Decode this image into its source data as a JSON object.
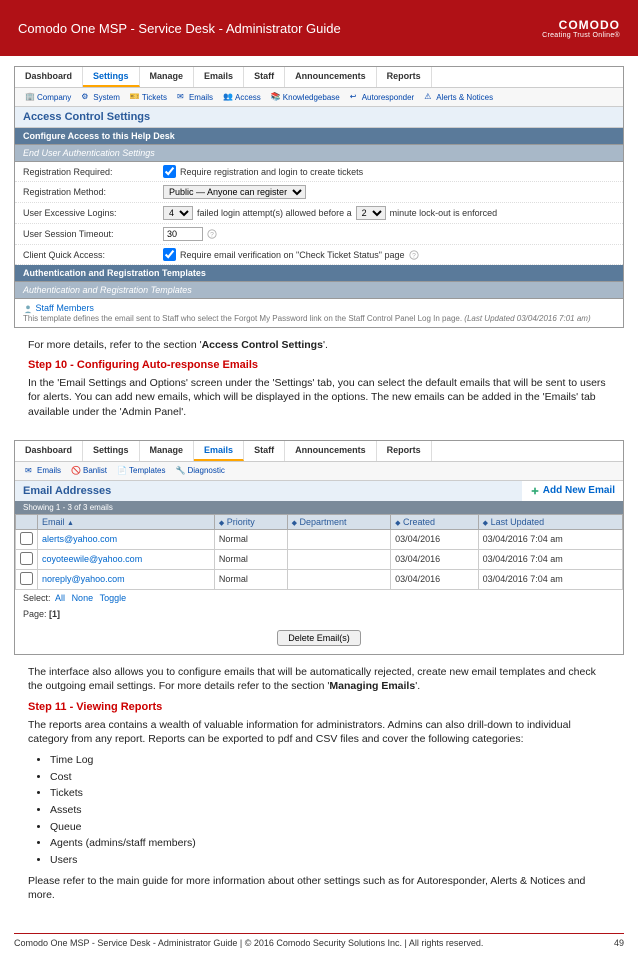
{
  "header": {
    "title": "Comodo One MSP - Service Desk - Administrator Guide",
    "brand": "COMODO",
    "tagline": "Creating Trust Online®"
  },
  "shot1": {
    "tabs": [
      "Dashboard",
      "Settings",
      "Manage",
      "Emails",
      "Staff",
      "Announcements",
      "Reports"
    ],
    "active_tab": 1,
    "subnav": [
      "Company",
      "System",
      "Tickets",
      "Emails",
      "Access",
      "Knowledgebase",
      "Autoresponder",
      "Alerts & Notices"
    ],
    "panel_title": "Access Control Settings",
    "bar1": "Configure Access to this Help Desk",
    "bar2": "End User Authentication Settings",
    "rows": {
      "req_lbl": "Registration Required:",
      "req_val": "Require registration and login to create tickets",
      "method_lbl": "Registration Method:",
      "method_val": "Public — Anyone can register",
      "logins_lbl": "User Excessive Logins:",
      "logins_attempts": "4",
      "logins_text": "failed login attempt(s) allowed before a",
      "logins_minutes": "2",
      "logins_text2": "minute lock-out is enforced",
      "sess_lbl": "User Session Timeout:",
      "sess_val": "30",
      "quick_lbl": "Client Quick Access:",
      "quick_val": "Require email verification on \"Check Ticket Status\" page"
    },
    "bar3": "Authentication and Registration Templates",
    "bar4": "Authentication and Registration Templates",
    "template": {
      "link": "Staff Members",
      "desc": "This template defines the email sent to Staff who select the Forgot My Password link on the Staff Control Panel Log In page.",
      "updated": "(Last Updated 03/04/2016 7:01 am)"
    }
  },
  "body1": {
    "p1a": "For more details, refer to the section '",
    "p1b": "Access Control Settings",
    "p1c": "'.",
    "h": "Step 10 - Configuring Auto-response Emails",
    "p2": "In the 'Email Settings and Options' screen under the 'Settings' tab, you can select the default emails that will be sent to users for alerts. You can add new emails, which will be displayed in the options. The new emails can be added in the 'Emails' tab available under the 'Admin Panel'."
  },
  "shot2": {
    "tabs": [
      "Dashboard",
      "Settings",
      "Manage",
      "Emails",
      "Staff",
      "Announcements",
      "Reports"
    ],
    "active_tab": 3,
    "subnav": [
      "Emails",
      "Banlist",
      "Templates",
      "Diagnostic"
    ],
    "panel_title": "Email Addresses",
    "add_link": "Add New Email",
    "summary": "Showing  1 - 3 of 3 emails",
    "cols": [
      "Email",
      "Priority",
      "Department",
      "Created",
      "Last Updated"
    ],
    "rows": [
      {
        "email": "alerts@yahoo.com",
        "priority": "Normal",
        "dept": "",
        "created": "03/04/2016",
        "updated": "03/04/2016 7:04 am"
      },
      {
        "email": "coyoteewile@yahoo.com",
        "priority": "Normal",
        "dept": "",
        "created": "03/04/2016",
        "updated": "03/04/2016 7:04 am"
      },
      {
        "email": "noreply@yahoo.com",
        "priority": "Normal",
        "dept": "",
        "created": "03/04/2016",
        "updated": "03/04/2016 7:04 am"
      }
    ],
    "select_lbl": "Select",
    "select_all": "All",
    "select_none": "None",
    "select_toggle": "Toggle",
    "page_lbl": "Page:",
    "page_num": "[1]",
    "delete_btn": "Delete Email(s)"
  },
  "body2": {
    "p1a": "The interface also allows you to configure emails that will be automatically rejected, create new email templates and check the outgoing email settings. For more details refer to the section '",
    "p1b": "Managing Emails",
    "p1c": "'.",
    "h": "Step 11 - Viewing Reports",
    "p2": "The reports area contains a wealth of valuable information for administrators. Admins can also drill-down to individual category from any report. Reports can be exported to pdf and CSV files and cover the following categories:",
    "bullets": [
      "Time Log",
      "Cost",
      "Tickets",
      "Assets",
      "Queue",
      "Agents (admins/staff members)",
      "Users"
    ],
    "p3": "Please refer to the main guide for more information about other settings such as for Autoresponder, Alerts & Notices and more."
  },
  "footer": {
    "left": "Comodo One MSP - Service Desk - Administrator Guide | © 2016 Comodo Security Solutions Inc. | All rights reserved.",
    "page": "49"
  }
}
